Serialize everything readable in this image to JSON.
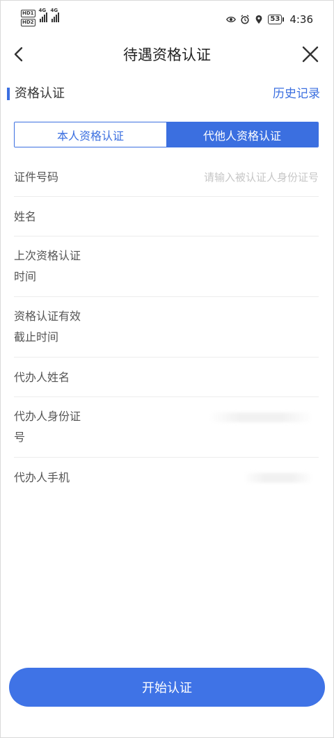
{
  "status_bar": {
    "hd1": "HD1",
    "hd2": "HD2",
    "net1": "4G",
    "net2": "4G",
    "battery": "53",
    "time": "4:36"
  },
  "header": {
    "title": "待遇资格认证",
    "back_icon": "chevron-left-icon",
    "close_icon": "close-icon"
  },
  "section": {
    "title": "资格认证",
    "history_link": "历史记录"
  },
  "tabs": [
    {
      "label": "本人资格认证",
      "active": false
    },
    {
      "label": "代他人资格认证",
      "active": true
    }
  ],
  "form": {
    "id_number": {
      "label": "证件号码",
      "placeholder": "请输入被认证人身份证号"
    },
    "name": {
      "label": "姓名"
    },
    "last_cert_time": {
      "label_line1": "上次资格认证",
      "label_line2": "时间"
    },
    "cert_deadline": {
      "label_line1": "资格认证有效",
      "label_line2": "截止时间"
    },
    "agent_name": {
      "label": "代办人姓名"
    },
    "agent_id": {
      "label_line1": "代办人身份证",
      "label_line2": "号"
    },
    "agent_phone": {
      "label": "代办人手机"
    }
  },
  "actions": {
    "start_label": "开始认证"
  },
  "colors": {
    "accent": "#3b6fe0",
    "button": "#3f73e6"
  }
}
